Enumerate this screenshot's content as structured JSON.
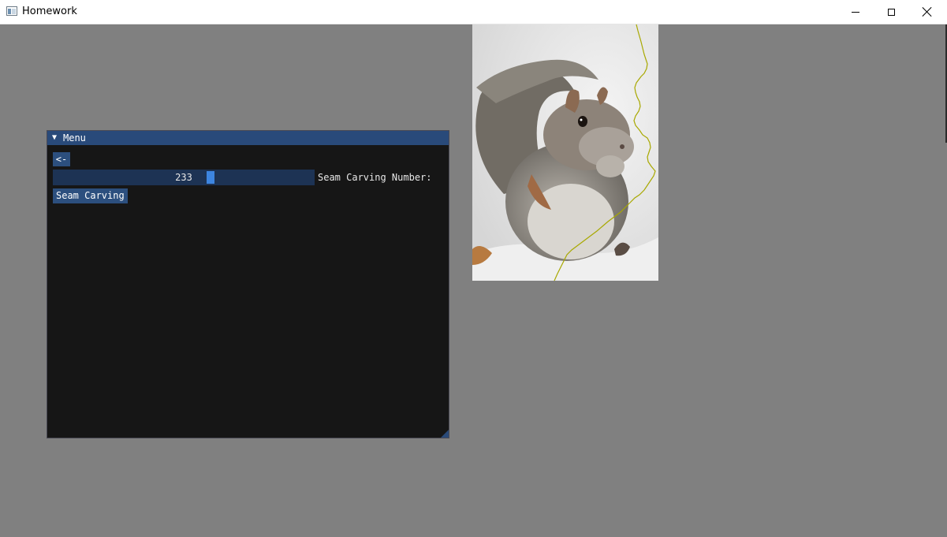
{
  "window": {
    "title": "Homework",
    "icon": "app-window-icon"
  },
  "panel": {
    "title": "Menu",
    "collapse_icon": "collapse-triangle-icon",
    "back_button": "<-",
    "slider": {
      "value": "233",
      "fraction": 0.605,
      "label": "Seam Carving Number:"
    },
    "seam_button": "Seam Carving"
  },
  "image": {
    "subject": "squirrel",
    "seam_color": "#a8a800"
  },
  "colors": {
    "background": "#808080",
    "panel_bg": "#161616",
    "header": "#294a7a",
    "button": "#2c4f7e",
    "slider_bg": "#1d3354",
    "slider_grab": "#3d85e0"
  }
}
